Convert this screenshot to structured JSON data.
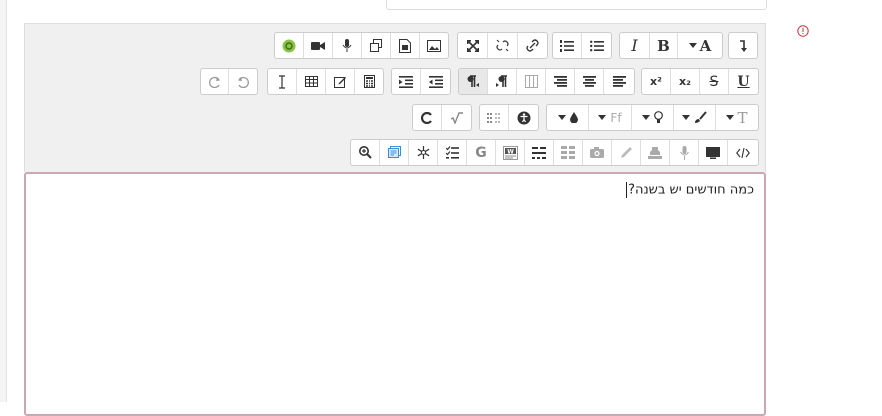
{
  "editor": {
    "content": "כמה חודשים יש בשנה?",
    "toolbar": {
      "rows": [
        [
          {
            "group": "media",
            "items": [
              "moodle-media-icon",
              "video-icon",
              "record-audio-icon",
              "copy-icon",
              "file-icon",
              "image-icon"
            ]
          },
          {
            "group": "links",
            "items": [
              "fullscreen-icon",
              "unlink-icon",
              "link-icon"
            ]
          },
          {
            "group": "lists",
            "items": [
              "ordered-list-icon",
              "unordered-list-icon"
            ]
          },
          {
            "group": "formatting",
            "items": [
              "italic-icon",
              "bold-icon",
              "font-size-icon",
              "collapse-icon"
            ]
          }
        ],
        [
          {
            "group": "history",
            "items": [
              "redo-icon",
              "undo-icon"
            ]
          },
          {
            "group": "insert",
            "items": [
              "cursor-icon",
              "table-icon",
              "edit-icon",
              "calculator-icon"
            ]
          },
          {
            "group": "indent",
            "items": [
              "indent-icon",
              "outdent-icon"
            ]
          },
          {
            "group": "direction",
            "items": [
              "rtl-icon",
              "ltr-icon",
              "columns-icon",
              "align-right-icon",
              "align-center-icon",
              "align-left-icon"
            ]
          },
          {
            "group": "script",
            "items": [
              "superscript-icon",
              "subscript-icon",
              "strikethrough-icon",
              "underline-icon"
            ]
          }
        ],
        [
          {
            "group": "clear",
            "items": [
              "clear-format-icon",
              "equation-icon"
            ]
          },
          {
            "group": "a11y",
            "items": [
              "chars-icon",
              "accessibility-icon"
            ]
          },
          {
            "group": "colors",
            "items": [
              "color-icon",
              "font-family-icon",
              "highlight-icon",
              "paint-icon",
              "text-style-icon"
            ]
          }
        ],
        [
          {
            "group": "tools",
            "items": [
              "zoom-icon",
              "comment-icon",
              "snowflake-icon",
              "checklist-icon",
              "google-icon",
              "word-icon",
              "split-icon",
              "cards-icon",
              "camera-icon",
              "pencil-icon",
              "stamp-icon",
              "mic-icon",
              "screen-icon",
              "code-icon"
            ]
          }
        ]
      ],
      "labels": {
        "italic": "I",
        "bold": "B",
        "font_size": "A",
        "superscript": "x²",
        "subscript": "x₂",
        "strikethrough": "S",
        "underline": "U",
        "google": "G",
        "font_family": "Ff",
        "text_style": "T"
      }
    }
  },
  "colors": {
    "toolbar_bg": "#f0f0f0",
    "content_border": "#c9a7b4",
    "warning": "#cc3333",
    "moodle_green": "#8bc34a"
  }
}
